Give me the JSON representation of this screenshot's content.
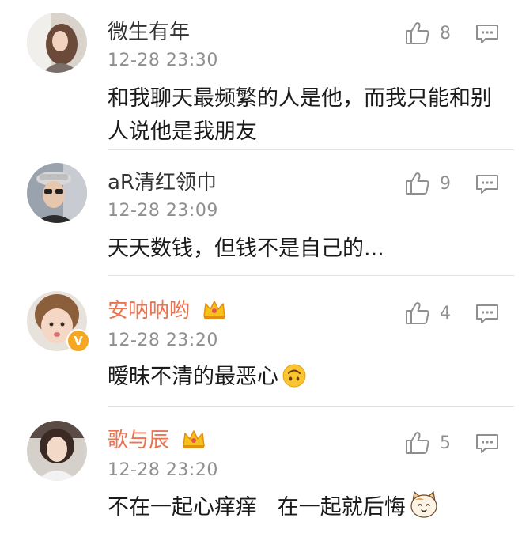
{
  "comments": [
    {
      "name": "微生有年",
      "time": "12-28 23:30",
      "text": "和我聊天最频繁的人是他，而我只能和别人说他是我朋友",
      "likes": "8",
      "vip": false,
      "verified": false
    },
    {
      "name": "aR清红领巾",
      "time": "12-28 23:09",
      "text": "天天数钱，但钱不是自己的...",
      "likes": "9",
      "vip": false,
      "verified": false
    },
    {
      "name": "安呐呐哟",
      "time": "12-28 23:20",
      "text": "暧昧不清的最恶心",
      "likes": "4",
      "vip": true,
      "verified": true,
      "verified_mark": "V"
    },
    {
      "name": "歌与辰",
      "time": "12-28 23:20",
      "text": "不在一起心痒痒   在一起就后悔",
      "likes": "5",
      "vip": true,
      "verified": false
    }
  ],
  "colors": {
    "vip_name": "#eb7350",
    "name": "#333333",
    "meta": "#8f8f8f",
    "divider": "#e3e3e3"
  },
  "icons": {
    "like": "thumbs-up-icon",
    "reply": "comment-bubble-icon",
    "vip": "crown-icon",
    "emoji_1": "upside-down-face-icon",
    "emoji_2": "cat-face-icon"
  }
}
